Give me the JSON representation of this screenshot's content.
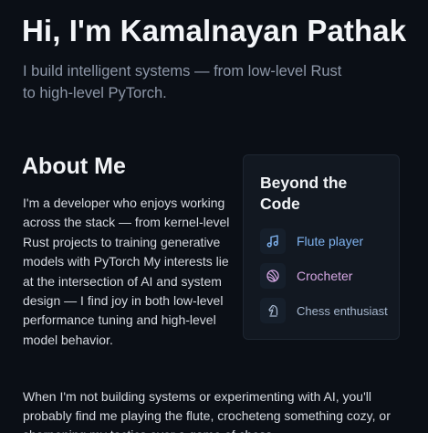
{
  "hero": {
    "title": "Hi, I'm Kamalnayan Pathak",
    "subtitle": "I build intelligent systems — from low-level Rust to high-level PyTorch."
  },
  "about": {
    "heading": "About Me",
    "paragraph": "I'm a developer who enjoys working across the stack — from kernel-level Rust projects to training generative models with PyTorch My interests lie at the intersection of AI and system design — I find joy in both low-level performance tuning and high-level model behavior.",
    "paragraph2": "When I'm not building systems or experimenting with AI, you'll probably find me playing the flute, crocheteng something cozy, or sharpening my tactics over a game of chess."
  },
  "beyond": {
    "title": "Beyond the Code",
    "items": [
      {
        "label": "Flute player",
        "icon": "music-note-icon",
        "color": "#7fb3f0"
      },
      {
        "label": "Crocheter",
        "icon": "yarn-ball-icon",
        "color": "#d4a6e2"
      },
      {
        "label": "Chess enthusiast",
        "icon": "chess-knight-icon",
        "color": "#a7b8cf"
      }
    ]
  },
  "colors": {
    "background": "#0b0f16",
    "card_background": "#121821",
    "subtitle": "#8d97a8"
  }
}
